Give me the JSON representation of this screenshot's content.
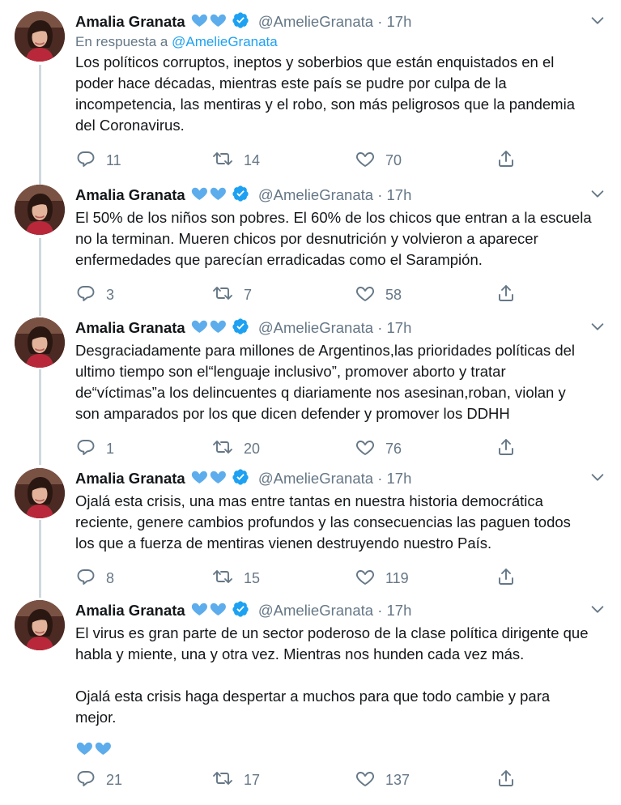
{
  "author": {
    "name": "Amalia Granata",
    "handle": "@AmelieGranata",
    "separator": "·"
  },
  "colors": {
    "text": "#14171a",
    "muted": "#657786",
    "accent": "#1da1f2",
    "heart_emoji": "#5dadec",
    "thread_line": "#cfd9de"
  },
  "icons": {
    "verified": "verified-badge-icon",
    "hearts": "blue-heart-emoji-icon",
    "more": "chevron-down-icon",
    "reply": "reply-icon",
    "retweet": "retweet-icon",
    "like": "like-icon",
    "share": "share-icon"
  },
  "tweets": [
    {
      "time": "17h",
      "reply_to_prefix": "En respuesta a",
      "reply_to_mention": "@AmelieGranata",
      "text": "Los políticos corruptos, ineptos y soberbios que están enquistados en el\npoder hace décadas, mientras este país se pudre por culpa de la\nincompetencia, las mentiras y el robo, son más peligrosos que la pandemia\ndel Coronavirus.",
      "replies": "11",
      "retweets": "14",
      "likes": "70"
    },
    {
      "time": "17h",
      "text": "El 50% de los niños son pobres. El 60% de los chicos que entran a la escuela\nno la terminan. Mueren chicos por desnutrición y volvieron a aparecer\nenfermedades que parecían erradicadas como el Sarampión.",
      "replies": "3",
      "retweets": "7",
      "likes": "58"
    },
    {
      "time": "17h",
      "text": "Desgraciadamente para millones de Argentinos,las prioridades políticas del\nultimo tiempo son el“lenguaje inclusivo”, promover aborto y tratar\nde“víctimas”a los delincuentes q diariamente nos asesinan,roban, violan y\nson amparados por los que dicen defender y promover los DDHH",
      "replies": "1",
      "retweets": "20",
      "likes": "76"
    },
    {
      "time": "17h",
      "text": "Ojalá esta crisis, una mas entre tantas en nuestra historia democrática\nreciente, genere cambios profundos y las consecuencias las paguen todos\nlos que a fuerza de mentiras vienen destruyendo nuestro País.",
      "replies": "8",
      "retweets": "15",
      "likes": "119"
    },
    {
      "time": "17h",
      "text": "El virus es gran parte de un sector poderoso de la clase política dirigente que\nhabla y miente, una y otra vez. Mientras nos hunden cada vez más.\n\nOjalá esta crisis haga despertar a muchos para que todo cambie y para\nmejor.",
      "replies": "21",
      "retweets": "17",
      "likes": "137"
    }
  ]
}
